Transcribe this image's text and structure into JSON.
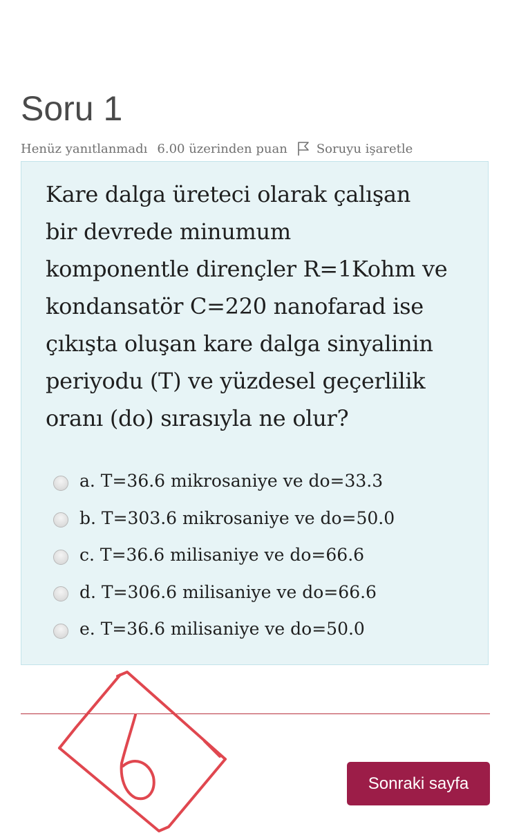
{
  "question": {
    "title": "Soru 1",
    "state": "Henüz yanıtlanmadı",
    "grade": "6.00 üzerinden puan",
    "flag_label": "Soruyu işaretle",
    "text_lines": [
      "Kare dalga üreteci olarak çalışan",
      "bir devrede minumum",
      "komponentle dirençler R=1Kohm ve",
      "kondansatör C=220 nanofarad ise",
      "çıkışta oluşan kare dalga sinyalinin",
      "periyodu (T) ve yüzdesel geçerlilik",
      "oranı (do) sırasıyla ne olur?"
    ],
    "answers": [
      {
        "label": "a. T=36.6 mikrosaniye ve do=33.3",
        "selected": false
      },
      {
        "label": "b. T=303.6 mikrosaniye ve do=50.0",
        "selected": false
      },
      {
        "label": "c. T=36.6 milisaniye ve do=66.6",
        "selected": false
      },
      {
        "label": "d. T=306.6 milisaniye ve do=66.6",
        "selected": false
      },
      {
        "label": "e. T=36.6 milisaniye ve do=50.0",
        "selected": false
      }
    ]
  },
  "navigation": {
    "next_label": "Sonraki sayfa"
  },
  "colors": {
    "question_background": "#e7f4f6",
    "question_border": "#c3e3ea",
    "next_button": "#9c1d48",
    "divider": "#b8323e",
    "annotation_ink": "#e0474f"
  },
  "icons": {
    "flag": "flag-icon",
    "annotation": "handwritten-letter-b-in-diamond"
  },
  "annotation": {
    "handwritten_text": "b"
  }
}
